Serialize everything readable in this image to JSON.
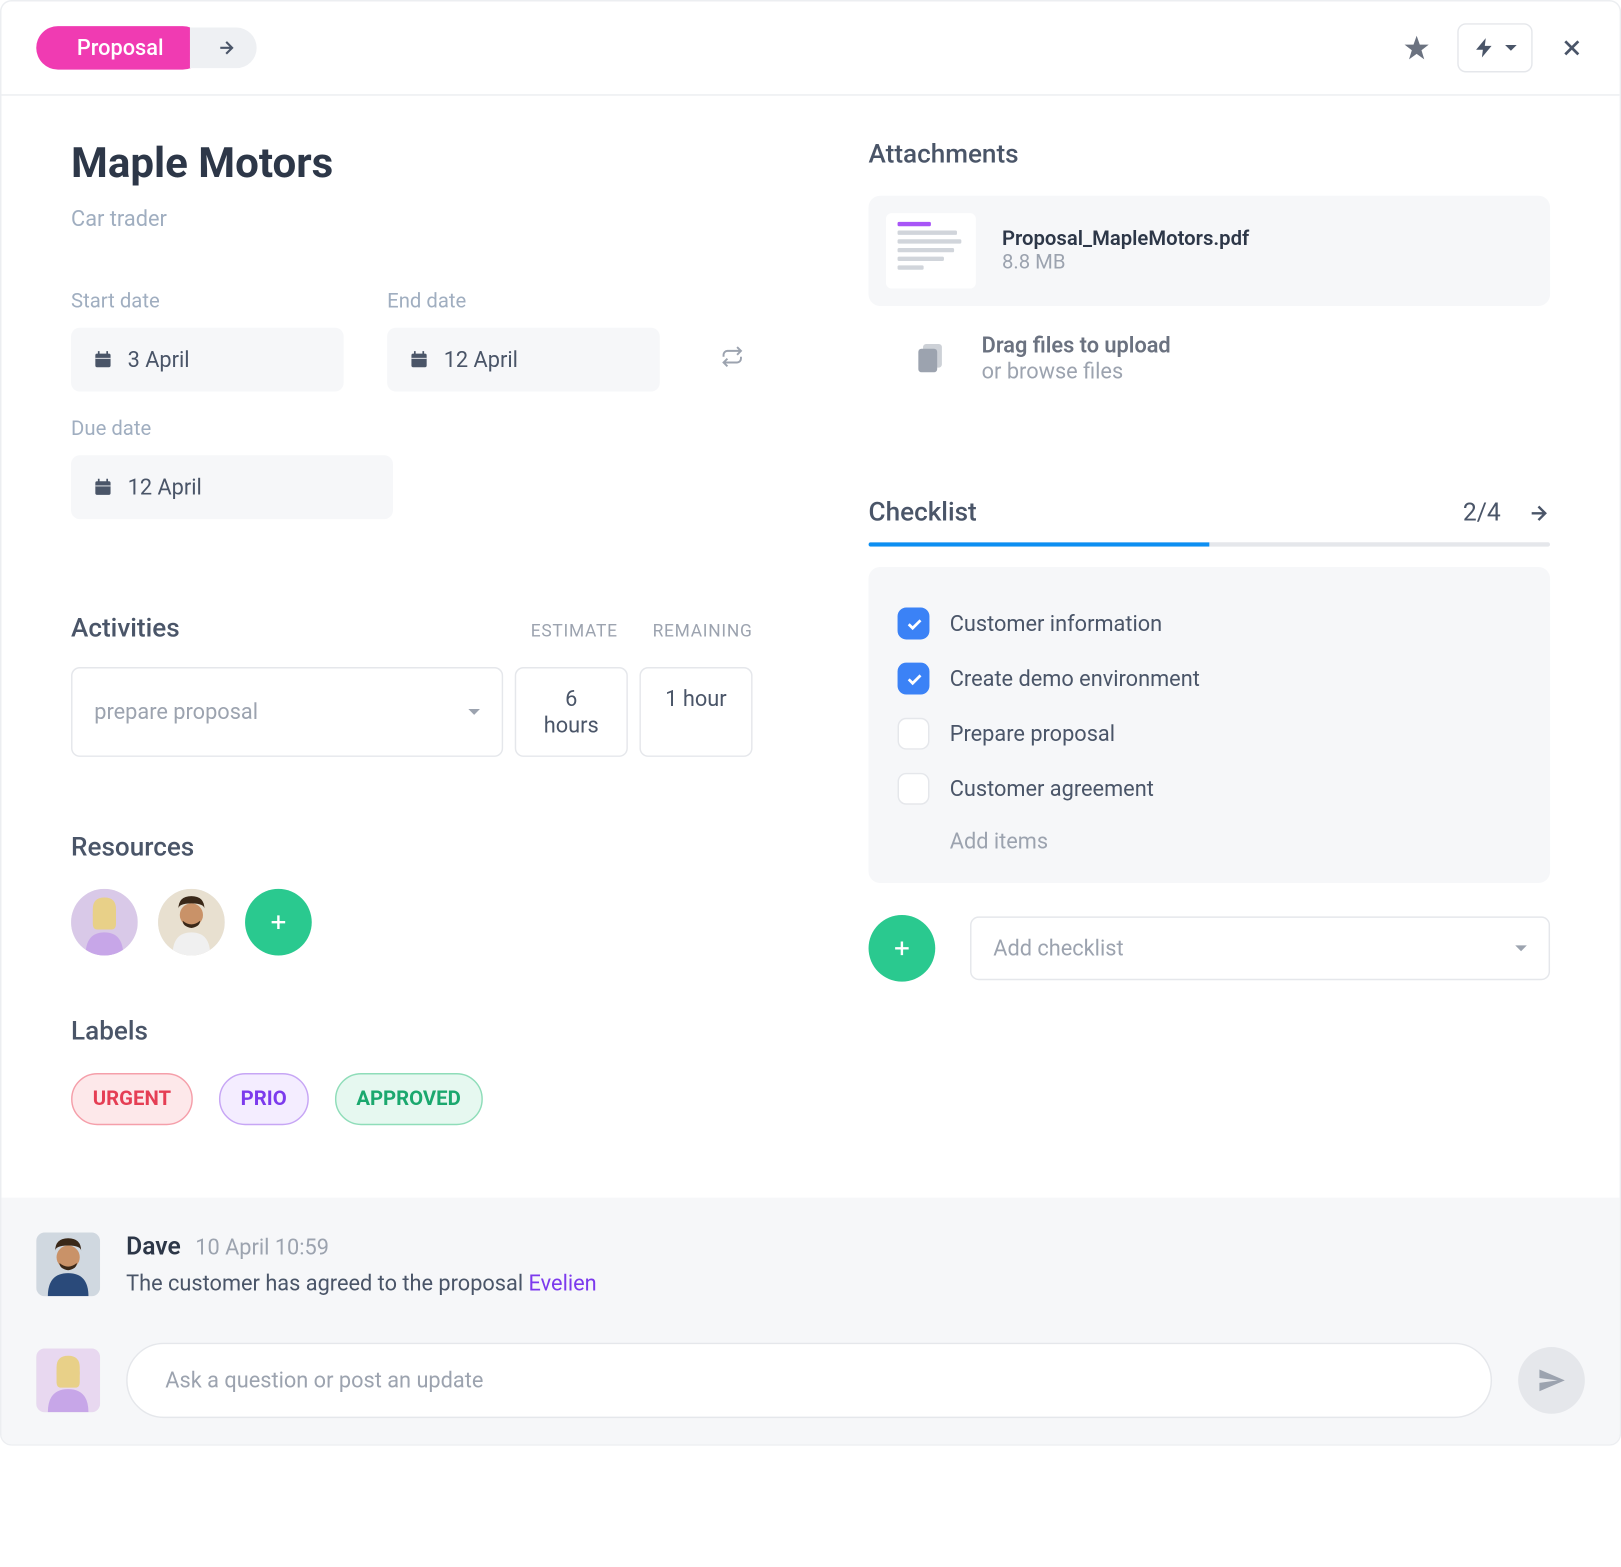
{
  "header": {
    "stage": "Proposal"
  },
  "record": {
    "title": "Maple Motors",
    "subtitle": "Car trader"
  },
  "dates": {
    "start_label": "Start date",
    "start_value": "3 April",
    "end_label": "End date",
    "end_value": "12 April",
    "due_label": "Due date",
    "due_value": "12 April"
  },
  "activities": {
    "title": "Activities",
    "estimate_label": "ESTIMATE",
    "remaining_label": "REMAINING",
    "items": [
      {
        "name": "prepare proposal",
        "estimate": "6 hours",
        "remaining": "1 hour"
      }
    ]
  },
  "resources": {
    "title": "Resources"
  },
  "labels": {
    "title": "Labels",
    "items": [
      "URGENT",
      "PRIO",
      "APPROVED"
    ]
  },
  "attachments": {
    "title": "Attachments",
    "file": {
      "name": "Proposal_MapleMotors.pdf",
      "size": "8.8 MB"
    },
    "upload_main": "Drag files to upload",
    "upload_sub": "or browse files"
  },
  "checklist": {
    "title": "Checklist",
    "progress": "2/4",
    "progress_pct": 50,
    "items": [
      {
        "label": "Customer information",
        "checked": true
      },
      {
        "label": "Create demo environment",
        "checked": true
      },
      {
        "label": "Prepare proposal",
        "checked": false
      },
      {
        "label": "Customer agreement",
        "checked": false
      }
    ],
    "add_items": "Add items",
    "add_checklist_placeholder": "Add checklist"
  },
  "comments": [
    {
      "author": "Dave",
      "timestamp": "10 April 10:59",
      "text": "The customer has agreed to the proposal ",
      "mention": "Evelien"
    }
  ],
  "compose": {
    "placeholder": "Ask a question or post an update"
  }
}
